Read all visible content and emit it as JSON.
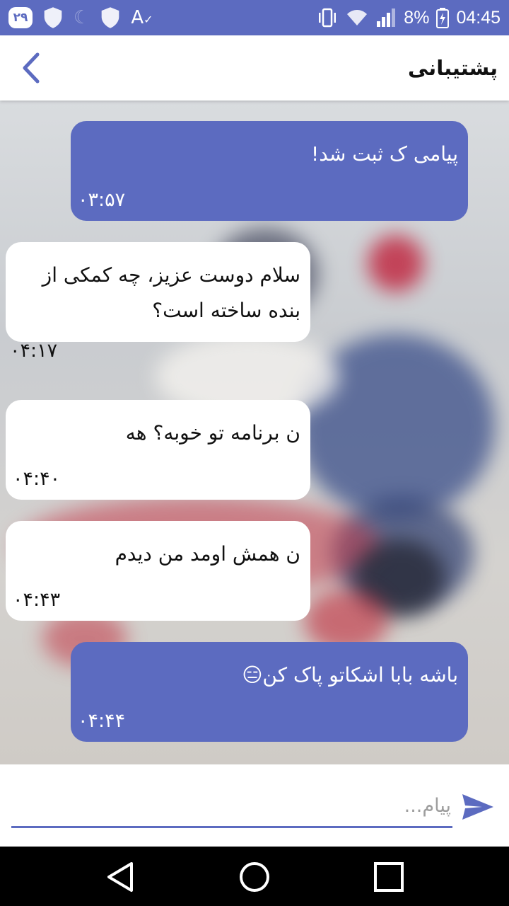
{
  "status_bar": {
    "notification_badge": "۲۹",
    "battery_percent": "8%",
    "time": "04:45",
    "icons": [
      "shield-icon",
      "moon-icon",
      "shield-icon",
      "font-size-icon",
      "vibrate-icon",
      "wifi-icon",
      "signal-icon",
      "battery-icon"
    ]
  },
  "app_bar": {
    "title": "پشتیبانی",
    "back_icon": "chevron-left-icon"
  },
  "messages": [
    {
      "side": "me",
      "text": "پیامی ک ثبت شد!",
      "time": "۰۳:۵۷"
    },
    {
      "side": "them",
      "text": "سلام دوست عزیز، چه کمکی از بنده ساخته است؟",
      "time": "۰۴:۱۷"
    },
    {
      "side": "them",
      "text": "ن برنامه تو خوبه؟ هه",
      "time": "۰۴:۴۰"
    },
    {
      "side": "them",
      "text": "ن همش اومد من دیدم",
      "time": "۰۴:۴۳"
    },
    {
      "side": "me",
      "text": "باشه بابا اشکاتو پاک کن😑",
      "time": "۰۴:۴۴"
    }
  ],
  "composer": {
    "placeholder": "پیام...",
    "value": "",
    "send_icon": "send-icon"
  },
  "nav_bar": {
    "icons": [
      "back-triangle-icon",
      "home-circle-icon",
      "recents-square-icon"
    ]
  },
  "colors": {
    "accent": "#5c6bc0",
    "incoming_bubble": "#ffffff",
    "outgoing_bubble": "#5c6bc0"
  }
}
